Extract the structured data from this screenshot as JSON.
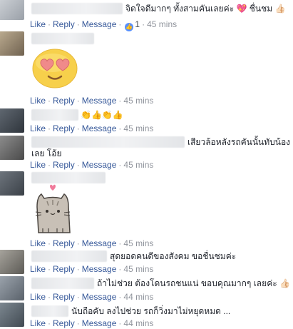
{
  "comments": [
    {
      "text": "จิดใจดีมากๆ ทั้งสามคันเลยค่ะ 💖 ชื่นชม 👍🏻",
      "actions": {
        "like": "Like",
        "reply": "Reply",
        "message": "Message",
        "reaction_count": "1",
        "time": "45 mins"
      }
    },
    {
      "sticker": "heart-eyes-emoji",
      "actions": {
        "like": "Like",
        "reply": "Reply",
        "message": "Message",
        "time": "45 mins"
      }
    },
    {
      "text": "👏👍👏👍",
      "actions": {
        "like": "Like",
        "reply": "Reply",
        "message": "Message",
        "time": "45 mins"
      }
    },
    {
      "text_line1": "เสียวล้อหลังรถคันนั้นทับน้อง",
      "text_line2": "เลย โอ้ย",
      "actions": {
        "like": "Like",
        "reply": "Reply",
        "message": "Message",
        "time": "45 mins"
      }
    },
    {
      "sticker": "pusheen-cat-heart",
      "actions": {
        "like": "Like",
        "reply": "Reply",
        "message": "Message",
        "time": "45 mins"
      }
    },
    {
      "text": "สุดยอดคนดีของสังคม ขอชื่นชมค่ะ",
      "actions": {
        "like": "Like",
        "reply": "Reply",
        "message": "Message",
        "time": "45 mins"
      }
    },
    {
      "text": "ถ้าไม่ช่วย ต้องโดนรถชนแน่ ขอบคุณมากๆ เลยค่ะ 👍🏻",
      "actions": {
        "like": "Like",
        "reply": "Reply",
        "message": "Message",
        "time": "44 mins"
      }
    },
    {
      "text": "นับถือคับ ลงไปช่วย รถก็วิ่งมาไม่หยุดหมด ...",
      "actions": {
        "like": "Like",
        "reply": "Reply",
        "message": "Message",
        "time": "44 mins"
      }
    }
  ],
  "colors": {
    "link": "#365899",
    "meta": "#90949c",
    "reaction": "#5890ff"
  }
}
